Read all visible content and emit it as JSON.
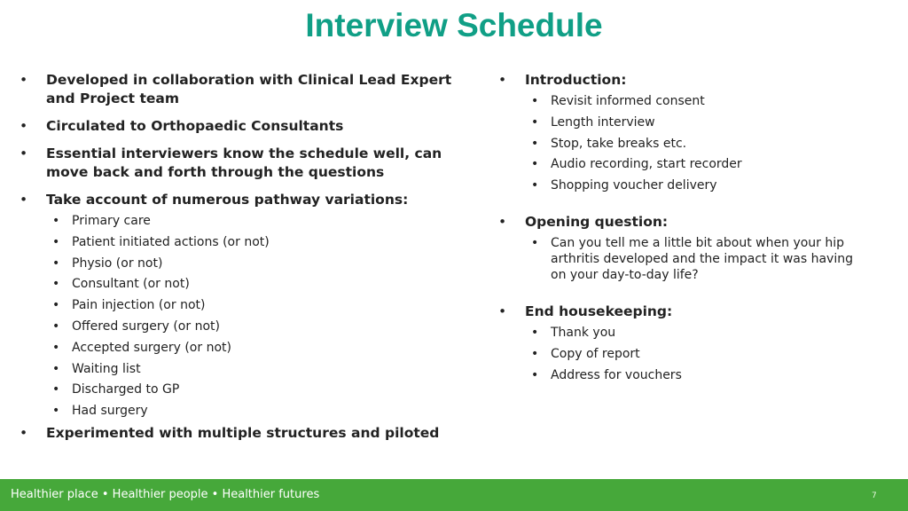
{
  "slide": {
    "title": "Interview Schedule",
    "page_number": "7",
    "footer_tagline": "Healthier place • Healthier people • Healthier futures",
    "bullet_glyph": "•",
    "colors": {
      "title": "#109f86",
      "footer_bar": "#46a83a",
      "footer_text": "#ffffff"
    }
  },
  "left_column": {
    "items": [
      {
        "text": "Developed in collaboration with Clinical Lead Expert and Project team"
      },
      {
        "text": "Circulated to Orthopaedic Consultants"
      },
      {
        "text": "Essential interviewers know the schedule well, can move back and forth through the questions"
      },
      {
        "text": "Take account of numerous pathway variations:",
        "sub": [
          "Primary care",
          "Patient initiated actions (or not)",
          "Physio (or not)",
          "Consultant (or not)",
          "Pain injection (or not)",
          "Offered surgery (or not)",
          "Accepted surgery (or not)",
          "Waiting list",
          "Discharged to GP",
          "Had surgery"
        ]
      },
      {
        "text": "Experimented with multiple structures and piloted"
      }
    ]
  },
  "right_column": {
    "sections": [
      {
        "heading": "Introduction:",
        "sub": [
          "Revisit informed consent",
          "Length interview",
          "Stop, take breaks etc.",
          "Audio recording, start recorder",
          "Shopping voucher delivery"
        ]
      },
      {
        "heading": "Opening question:",
        "sub": [
          "Can you tell me a little bit about when your hip arthritis developed and the impact it was having on your day-to-day life?"
        ]
      },
      {
        "heading": "End housekeeping:",
        "sub": [
          "Thank you",
          "Copy of report",
          "Address for vouchers"
        ]
      }
    ]
  }
}
